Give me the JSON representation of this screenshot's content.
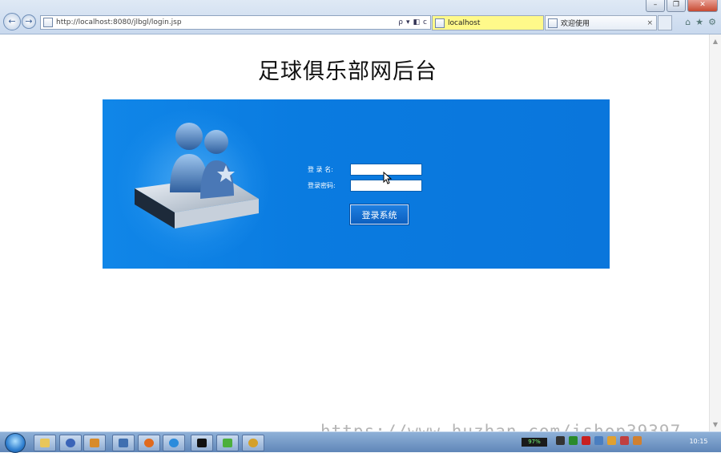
{
  "browser": {
    "url": "http://localhost:8080/jlbgl/login.jsp",
    "tabs": [
      {
        "label": "localhost",
        "active": true
      },
      {
        "label": "欢迎使用",
        "active": false
      }
    ],
    "tab_close": "×",
    "back_glyph": "←",
    "forward_glyph": "→",
    "address_tools": {
      "search": "ρ",
      "dropdown": "▾",
      "compat": "◧",
      "refresh": "c"
    },
    "window_controls": {
      "minimize": "–",
      "maximize": "❐",
      "close": "✕"
    },
    "command_icons": {
      "home": "⌂",
      "favorites": "★",
      "tools": "⚙"
    }
  },
  "page": {
    "title": "足球俱乐部网后台",
    "login_form": {
      "username_label": "登 录 名:",
      "username_value": "",
      "password_label": "登录密码:",
      "password_value": "",
      "submit_label": "登录系统"
    }
  },
  "watermark": "https://www.huzhan.com/ishop39397",
  "taskbar": {
    "battery": "97%",
    "clock": "10:15"
  },
  "colors": {
    "panel_blue": "#0a7be0",
    "button_blue": "#0c5fc0",
    "active_tab": "#fff98a"
  }
}
